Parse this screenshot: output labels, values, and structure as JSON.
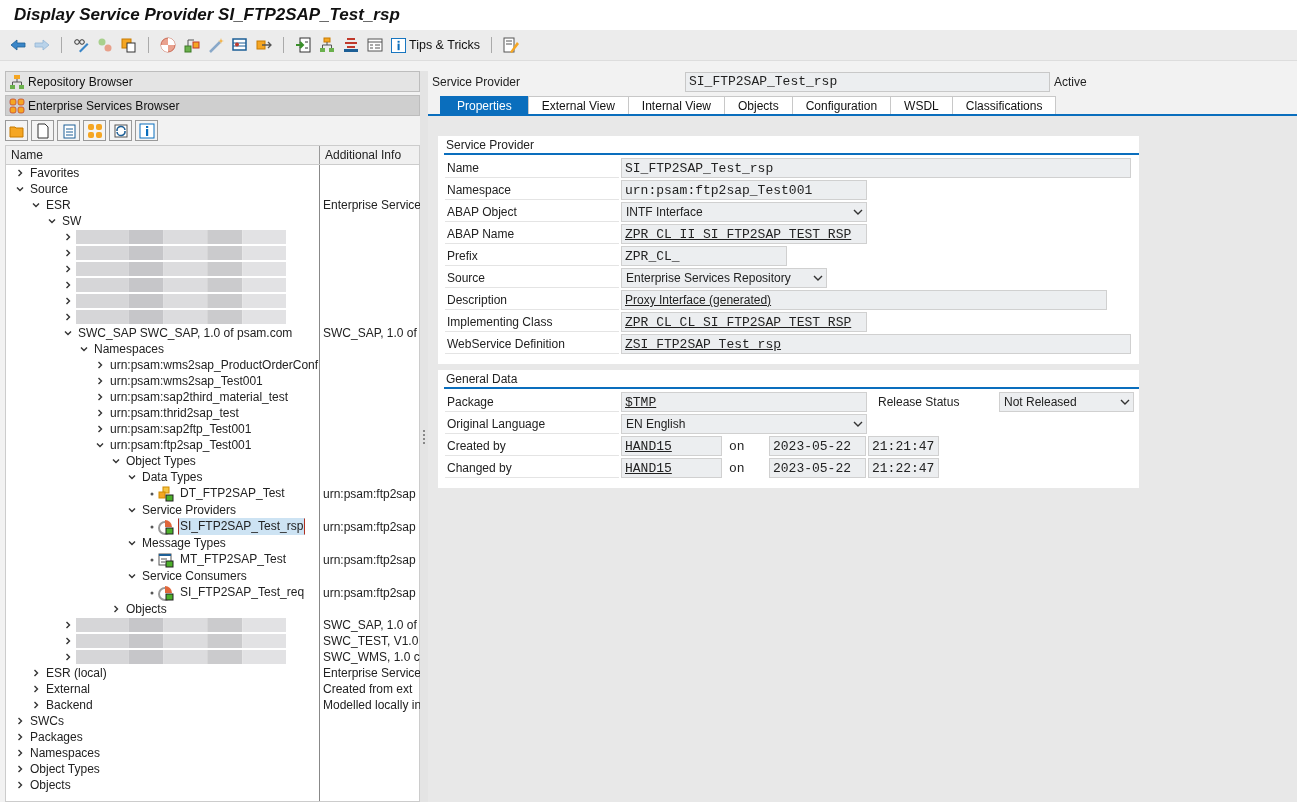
{
  "window": {
    "title": "Display Service Provider SI_FTP2SAP_Test_rsp"
  },
  "toolbar": {
    "tips_label": "Tips & Tricks"
  },
  "browser_panels": [
    {
      "label": "Repository Browser",
      "selected": false
    },
    {
      "label": "Enterprise Services Browser",
      "selected": true
    }
  ],
  "tree": {
    "columns": [
      "Name",
      "Additional Info"
    ],
    "nodes": [
      {
        "kind": "folder",
        "label": "Favorites",
        "expanded": false,
        "selected": false
      },
      {
        "kind": "folder",
        "label": "Source",
        "expanded": true,
        "selected": false,
        "children": [
          {
            "kind": "folder",
            "label": "ESR",
            "info": "Enterprise Service",
            "expanded": true,
            "selected": false,
            "children": [
              {
                "kind": "folder",
                "label": "SW",
                "expanded": true,
                "selected": false,
                "children": [
                  {
                    "kind": "redacted",
                    "expanded": false
                  },
                  {
                    "kind": "redacted",
                    "expanded": false
                  },
                  {
                    "kind": "redacted",
                    "expanded": false
                  },
                  {
                    "kind": "redacted",
                    "expanded": false
                  },
                  {
                    "kind": "redacted",
                    "expanded": false
                  },
                  {
                    "kind": "redacted",
                    "expanded": false
                  },
                  {
                    "kind": "folder",
                    "label": "SWC_SAP SWC_SAP, 1.0 of psam.com",
                    "info": "SWC_SAP, 1.0 of",
                    "expanded": true,
                    "selected": false,
                    "children": [
                      {
                        "kind": "folder",
                        "label": "Namespaces",
                        "expanded": true,
                        "selected": false,
                        "children": [
                          {
                            "kind": "folder",
                            "label": "urn:psam:wms2sap_ProductOrderConf",
                            "expanded": false,
                            "selected": false
                          },
                          {
                            "kind": "folder",
                            "label": "urn:psam:wms2sap_Test001",
                            "expanded": false,
                            "selected": false
                          },
                          {
                            "kind": "folder",
                            "label": "urn:psam:sap2third_material_test",
                            "expanded": false,
                            "selected": false
                          },
                          {
                            "kind": "folder",
                            "label": "urn:psam:thrid2sap_test",
                            "expanded": false,
                            "selected": false
                          },
                          {
                            "kind": "folder",
                            "label": "urn:psam:sap2ftp_Test001",
                            "expanded": false,
                            "selected": false
                          },
                          {
                            "kind": "folder",
                            "label": "urn:psam:ftp2sap_Test001",
                            "expanded": true,
                            "selected": false,
                            "children": [
                              {
                                "kind": "folder",
                                "label": "Object Types",
                                "expanded": true,
                                "selected": false,
                                "children": [
                                  {
                                    "kind": "folder",
                                    "label": "Data Types",
                                    "expanded": true,
                                    "selected": false,
                                    "children": [
                                      {
                                        "kind": "data-type",
                                        "label": "DT_FTP2SAP_Test",
                                        "info": "urn:psam:ftp2sap",
                                        "selected": false
                                      }
                                    ]
                                  },
                                  {
                                    "kind": "folder",
                                    "label": "Service Providers",
                                    "expanded": true,
                                    "selected": false,
                                    "children": [
                                      {
                                        "kind": "service-interface",
                                        "label": "SI_FTP2SAP_Test_rsp",
                                        "info": "urn:psam:ftp2sap",
                                        "selected": true
                                      }
                                    ]
                                  },
                                  {
                                    "kind": "folder",
                                    "label": "Message Types",
                                    "expanded": true,
                                    "selected": false,
                                    "children": [
                                      {
                                        "kind": "message-type",
                                        "label": "MT_FTP2SAP_Test",
                                        "info": "urn:psam:ftp2sap",
                                        "selected": false
                                      }
                                    ]
                                  },
                                  {
                                    "kind": "folder",
                                    "label": "Service Consumers",
                                    "expanded": true,
                                    "selected": false,
                                    "children": [
                                      {
                                        "kind": "service-interface",
                                        "label": "SI_FTP2SAP_Test_req",
                                        "info": "urn:psam:ftp2sap",
                                        "selected": false
                                      }
                                    ]
                                  }
                                ]
                              },
                              {
                                "kind": "folder",
                                "label": "Objects",
                                "expanded": false,
                                "selected": false
                              }
                            ]
                          }
                        ]
                      }
                    ]
                  },
                  {
                    "kind": "redacted",
                    "info": "SWC_SAP, 1.0 of",
                    "expanded": false
                  },
                  {
                    "kind": "redacted",
                    "info": "SWC_TEST, V1.0",
                    "expanded": false
                  },
                  {
                    "kind": "redacted",
                    "info": "SWC_WMS, 1.0 c",
                    "expanded": false
                  }
                ]
              }
            ]
          },
          {
            "kind": "folder",
            "label": "ESR (local)",
            "info": "Enterprise Service",
            "expanded": false,
            "selected": false
          },
          {
            "kind": "folder",
            "label": "External",
            "info": "Created from ext",
            "expanded": false,
            "selected": false
          },
          {
            "kind": "folder",
            "label": "Backend",
            "info": "Modelled locally in",
            "expanded": false,
            "selected": false
          }
        ]
      },
      {
        "kind": "folder",
        "label": "SWCs",
        "expanded": false,
        "selected": false
      },
      {
        "kind": "folder",
        "label": "Packages",
        "expanded": false,
        "selected": false
      },
      {
        "kind": "folder",
        "label": "Namespaces",
        "expanded": false,
        "selected": false
      },
      {
        "kind": "folder",
        "label": "Object Types",
        "expanded": false,
        "selected": false
      },
      {
        "kind": "folder",
        "label": "Objects",
        "expanded": false,
        "selected": false
      }
    ]
  },
  "header": {
    "label": "Service Provider",
    "value": "SI_FTP2SAP_Test_rsp",
    "status": "Active"
  },
  "tabs": [
    {
      "label": "Properties",
      "selected": true
    },
    {
      "label": "External View",
      "selected": false
    },
    {
      "label": "Internal View",
      "selected": false
    },
    {
      "label": "Objects",
      "selected": false
    },
    {
      "label": "Configuration",
      "selected": false
    },
    {
      "label": "WSDL",
      "selected": false
    },
    {
      "label": "Classifications",
      "selected": false
    }
  ],
  "sections": [
    {
      "title": "Service Provider",
      "rows": [
        {
          "label": "Name",
          "fields": [
            {
              "kind": "text",
              "value": "SI_FTP2SAP_Test_rsp",
              "link": false
            }
          ]
        },
        {
          "label": "Namespace",
          "fields": [
            {
              "kind": "text",
              "value": "urn:psam:ftp2sap_Test001",
              "link": false
            }
          ]
        },
        {
          "label": "ABAP Object",
          "fields": [
            {
              "kind": "select",
              "value": "INTF Interface",
              "link": false
            }
          ]
        },
        {
          "label": "ABAP Name",
          "fields": [
            {
              "kind": "text",
              "value": "ZPR_CL_II_SI_FTP2SAP_TEST_RSP",
              "link": true
            }
          ]
        },
        {
          "label": "Prefix",
          "fields": [
            {
              "kind": "text",
              "value": "ZPR_CL_",
              "link": false
            }
          ]
        },
        {
          "label": "Source",
          "fields": [
            {
              "kind": "select",
              "value": "Enterprise Services Repository",
              "link": false
            }
          ]
        },
        {
          "label": "Description",
          "fields": [
            {
              "kind": "plain",
              "value": "Proxy Interface (generated)",
              "link": true
            }
          ]
        },
        {
          "label": "Implementing Class",
          "fields": [
            {
              "kind": "text",
              "value": "ZPR_CL_CL_SI_FTP2SAP_TEST_RSP",
              "link": true
            }
          ]
        },
        {
          "label": "WebService Definition",
          "fields": [
            {
              "kind": "text",
              "value": "ZSI_FTP2SAP_Test_rsp",
              "link": true
            }
          ]
        }
      ]
    },
    {
      "title": "General Data",
      "rows": [
        {
          "label": "Package",
          "fields": [
            {
              "kind": "text",
              "value": "$TMP",
              "link": true
            },
            {
              "kind": "label",
              "value": "Release Status",
              "link": false
            },
            {
              "kind": "select",
              "value": "Not Released",
              "link": false
            }
          ]
        },
        {
          "label": "Original Language",
          "fields": [
            {
              "kind": "select",
              "value": "EN English",
              "link": false
            }
          ]
        },
        {
          "label": "Created by",
          "fields": [
            {
              "kind": "text",
              "value": "HAND15",
              "link": true
            },
            {
              "kind": "word",
              "value": "on",
              "link": false
            },
            {
              "kind": "text",
              "value": "2023-05-22",
              "link": false
            },
            {
              "kind": "text",
              "value": "21:21:47",
              "link": false
            }
          ]
        },
        {
          "label": "Changed by",
          "fields": [
            {
              "kind": "text",
              "value": "HAND15",
              "link": true
            },
            {
              "kind": "word",
              "value": "on",
              "link": false
            },
            {
              "kind": "text",
              "value": "2023-05-22",
              "link": false
            },
            {
              "kind": "text",
              "value": "21:22:47",
              "link": false
            }
          ]
        }
      ]
    }
  ]
}
